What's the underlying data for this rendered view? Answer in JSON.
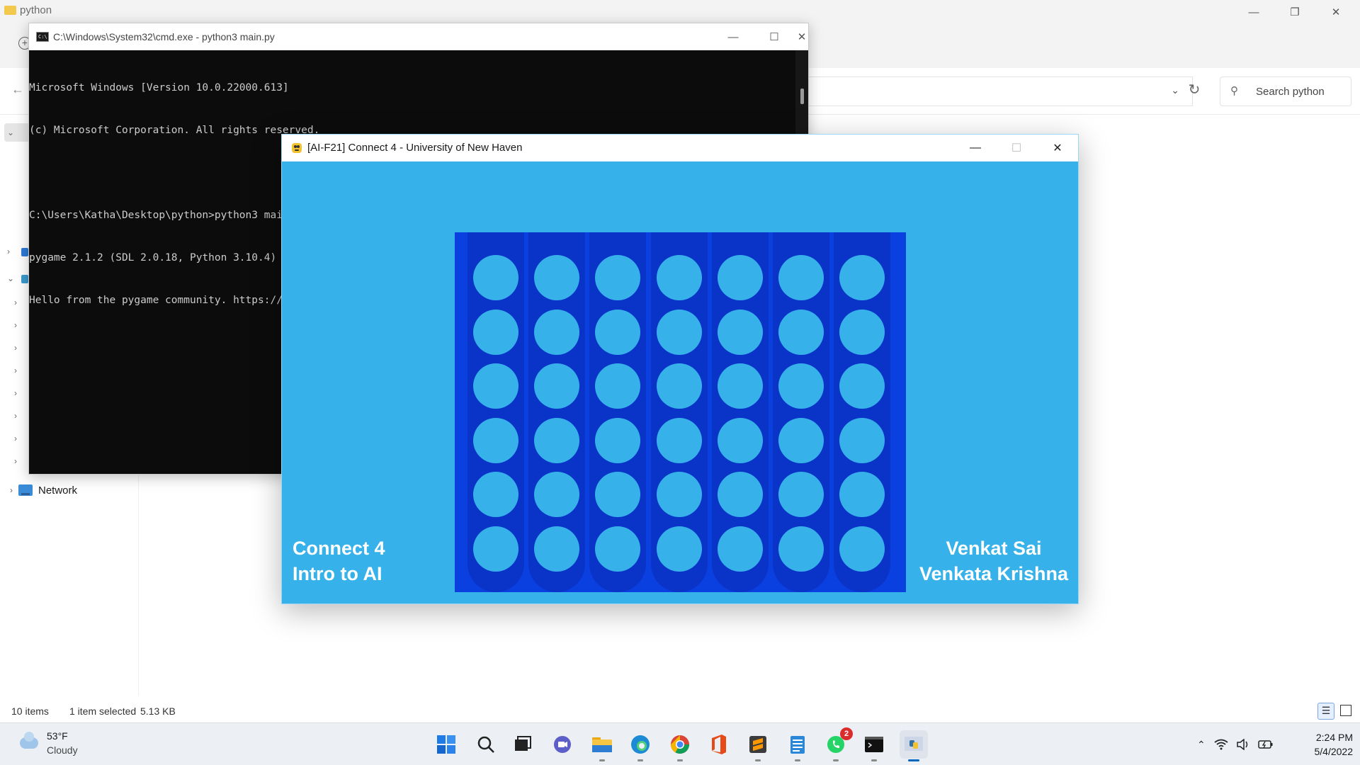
{
  "explorer": {
    "title": "python",
    "search_placeholder": "Search python",
    "network_label": "Network",
    "status": {
      "items": "10 items",
      "selected": "1 item selected",
      "size": "5.13 KB"
    }
  },
  "cmd": {
    "title": "C:\\Windows\\System32\\cmd.exe - python3  main.py",
    "lines": [
      "Microsoft Windows [Version 10.0.22000.613]",
      "(c) Microsoft Corporation. All rights reserved.",
      "",
      "C:\\Users\\Katha\\Desktop\\python>python3 main.py",
      "pygame 2.1.2 (SDL 2.0.18, Python 3.10.4)",
      "Hello from the pygame community. https://www.pygame.org/contribute.html"
    ]
  },
  "game": {
    "title": "[AI-F21] Connect 4 - University of New Haven",
    "board": {
      "rows": 6,
      "cols": 7
    },
    "left_text": [
      "Connect 4",
      "Intro to AI"
    ],
    "right_text": [
      "Venkat Sai",
      "Venkata Krishna"
    ],
    "colors": {
      "background": "#37b1ea",
      "board": "#0a3fe0",
      "column": "#0a33c8",
      "empty_slot": "#37b1ea"
    }
  },
  "taskbar": {
    "weather_temp": "53°F",
    "weather_cond": "Cloudy",
    "whatsapp_badge": "2",
    "time": "2:24 PM",
    "date": "5/4/2022",
    "apps": [
      "start-icon",
      "search-icon",
      "task-view-icon",
      "teams-chat-icon",
      "file-explorer-icon",
      "edge-icon",
      "chrome-icon",
      "office-icon",
      "sublime-text-icon",
      "notepad-icon",
      "whatsapp-icon",
      "terminal-icon",
      "python-icon"
    ]
  }
}
